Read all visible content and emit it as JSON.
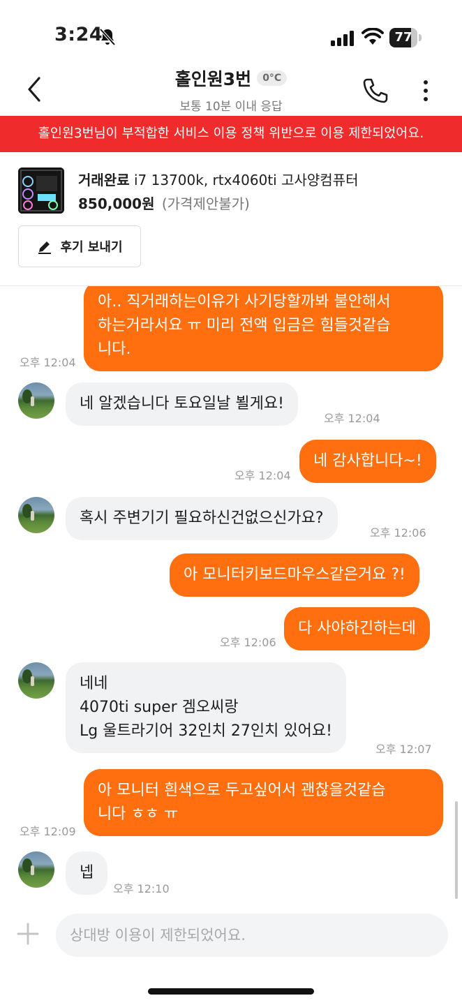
{
  "status_bar": {
    "time": "3:24",
    "battery": "77",
    "battery_level": 0.77,
    "icons": [
      "bell-off-icon",
      "signal-icon",
      "wifi-icon",
      "battery-icon"
    ]
  },
  "header": {
    "title": "홀인원3번",
    "temperature": "0°C",
    "subtitle": "보통 10분 이내 응답",
    "icons": [
      "back-icon",
      "phone-icon",
      "more-vertical-icon"
    ]
  },
  "warning": {
    "text": "홀인원3번님이 부적합한 서비스 이용 정책 위반으로 이용 제한되었어요."
  },
  "product": {
    "status": "거래완료",
    "name": "i7 13700k, rtx4060ti 고사양컴퓨터",
    "price": "850,000원",
    "price_note": "(가격제안불가)",
    "review_button": "후기 보내기"
  },
  "messages": [
    {
      "from": "me",
      "lines": [
        "아.. 직거래하는이유가 사기당할까봐 불안해서",
        "하는거라서요 ㅠ 미리 전액 입금은 힘들것같습",
        "니다."
      ],
      "time": "오후 12:04"
    },
    {
      "from": "them",
      "lines": [
        "네 알겠습니다 토요일날 뵐게요!"
      ],
      "time": "오후 12:04"
    },
    {
      "from": "me",
      "lines": [
        "네 감사합니다~!"
      ],
      "time": "오후 12:04"
    },
    {
      "from": "them",
      "lines": [
        "혹시 주변기기 필요하신건없으신가요?"
      ],
      "time": "오후 12:06"
    },
    {
      "from": "me",
      "lines": [
        "아 모니터키보드마우스같은거요 ?!"
      ],
      "time": ""
    },
    {
      "from": "me",
      "lines": [
        "다 사야하긴하는데"
      ],
      "time": "오후 12:06"
    },
    {
      "from": "them",
      "lines": [
        "네네",
        "4070ti super 겜오씨랑",
        "Lg 울트라기어 32인치 27인치 있어요!"
      ],
      "time": "오후 12:07"
    },
    {
      "from": "me",
      "lines": [
        "아 모니터 흰색으로 두고싶어서 괜찮을것같습",
        "니다 ㅎㅎ ㅠ"
      ],
      "time": "오후 12:09"
    },
    {
      "from": "them",
      "lines": [
        "넵"
      ],
      "time": "오후 12:10"
    }
  ],
  "input": {
    "placeholder": "상대방 이용이 제한되었어요."
  },
  "colors": {
    "accent": "#ff6f0f",
    "warning": "#ef2b2b",
    "incoming_bubble": "#f1f2f4"
  }
}
